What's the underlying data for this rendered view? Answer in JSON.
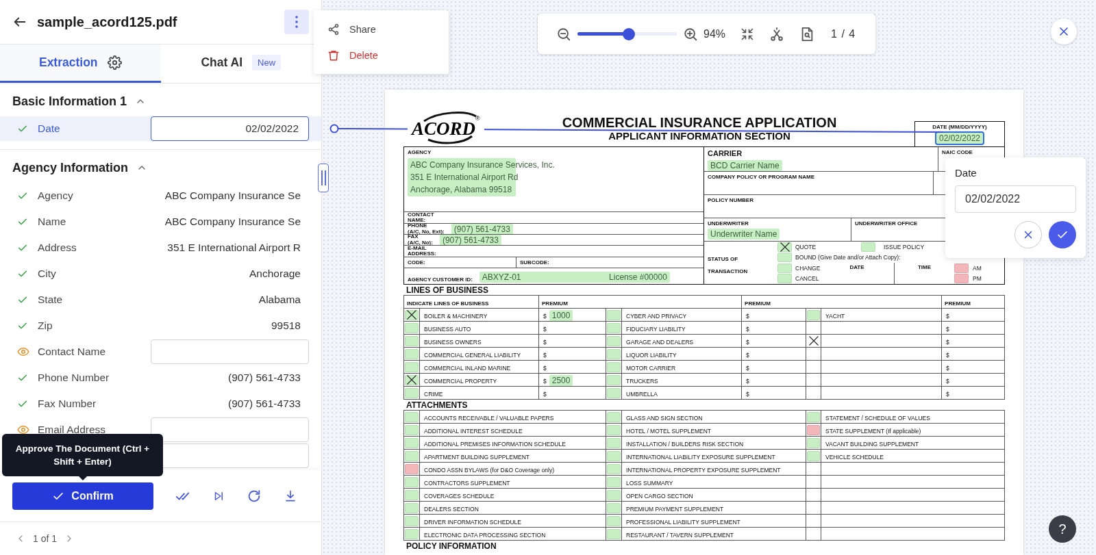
{
  "header": {
    "title": "sample_acord125.pdf"
  },
  "menu": [
    {
      "label": "Share",
      "kind": "share"
    },
    {
      "label": "Delete",
      "kind": "delete"
    }
  ],
  "tabs": [
    {
      "label": "Extraction",
      "selected": true
    },
    {
      "label": "Chat AI",
      "selected": false,
      "badge": "New"
    }
  ],
  "sections": [
    {
      "title": "Basic Information 1",
      "expanded": true,
      "fields": [
        {
          "label": "Date",
          "verified": true,
          "kind": "input",
          "value": "02/02/2022",
          "selected": true
        }
      ]
    },
    {
      "title": "Agency Information",
      "expanded": true,
      "fields": [
        {
          "label": "Agency",
          "verified": true,
          "kind": "text",
          "value": "ABC Company Insurance Se",
          "selected": false
        },
        {
          "label": "Name",
          "verified": true,
          "kind": "text",
          "value": "ABC Company Insurance Se",
          "selected": false
        },
        {
          "label": "Address",
          "verified": true,
          "kind": "text",
          "value": "351 E International Airport R",
          "selected": false
        },
        {
          "label": "City",
          "verified": true,
          "kind": "text",
          "value": "Anchorage",
          "selected": false
        },
        {
          "label": "State",
          "verified": true,
          "kind": "text",
          "value": "Alabama",
          "selected": false
        },
        {
          "label": "Zip",
          "verified": true,
          "kind": "text",
          "value": "99518",
          "selected": false
        },
        {
          "label": "Contact Name",
          "verified": false,
          "kind": "input",
          "selected": false
        },
        {
          "label": "Phone Number",
          "verified": true,
          "kind": "text",
          "value": "(907) 561-4733",
          "selected": false
        },
        {
          "label": "Fax Number",
          "verified": true,
          "kind": "text",
          "value": "(907) 561-4733",
          "selected": false
        },
        {
          "label": "Email Address",
          "verified": false,
          "kind": "input",
          "selected": false
        },
        {
          "kind": "input",
          "selected": false
        }
      ]
    }
  ],
  "tooltip": "Approve The Document (Ctrl + Shift + Enter)",
  "confirm": "Confirm",
  "pagination": {
    "text": "1 of 1"
  },
  "viewer": {
    "zoom": {
      "level": 0.52,
      "reading": "94%"
    },
    "page": "1 / 4"
  },
  "help": "?",
  "date_popup": {
    "label": "Date",
    "value": "02/02/2022"
  },
  "document": {
    "logo": "ACORD",
    "logo_mark": "®",
    "title": "COMMERCIAL INSURANCE APPLICATION",
    "subtitle": "APPLICANT INFORMATION SECTION",
    "date": {
      "label": "DATE (MM/DD/YYYY)",
      "value": "02/02/2022",
      "selected": true
    },
    "agency": {
      "label": "AGENCY",
      "lines": [
        "ABC Company Insurance Services, Inc.",
        "351 E International Airport Rd",
        "Anchorage, Alabama 99518"
      ]
    },
    "contacts": [
      {
        "label": "CONTACT\nNAME:"
      },
      {
        "label": "PHONE\n(A/C, No, Ext):",
        "value": "(907) 561-4733"
      },
      {
        "label": "FAX\n(A/C, No):",
        "value": "(907) 561-4733"
      },
      {
        "label": "E-MAIL\nADDRESS:"
      }
    ],
    "codes": [
      {
        "label": "CODE:"
      },
      {
        "label": "SUBCODE:"
      }
    ],
    "customer_id": {
      "label": "AGENCY CUSTOMER ID:",
      "value": "ABXYZ-01",
      "license": "License #00000"
    },
    "carrier": {
      "label": "CARRIER",
      "value": "BCD Carrier Name"
    },
    "naic": "NAIC CODE",
    "program": "COMPANY POLICY OR PROGRAM NAME",
    "policy_number": "POLICY NUMBER",
    "underwriter": {
      "label": "UNDERWRITER",
      "value": "Underwriter Name"
    },
    "underwriter_office": "UNDERWRITER OFFICE",
    "status": {
      "label": "STATUS OF\nTRANSACTION",
      "date_label": "DATE",
      "time_label": "TIME",
      "options": [
        {
          "label": "QUOTE",
          "checked": true,
          "color": "#c8efc3"
        },
        {
          "label": "ISSUE POLICY",
          "checked": false,
          "color": "#c8efc3"
        },
        {
          "label": "BOUND (Give Date and/or Attach Copy):",
          "checked": false,
          "color": "#c8efc3"
        },
        {
          "label": "CHANGE",
          "checked": false,
          "color": "#c8efc3"
        },
        {
          "label": "CANCEL",
          "checked": false,
          "color": "#c8efc3"
        }
      ],
      "times": [
        {
          "label": "AM",
          "checked": false,
          "color": "#f2b6bb"
        },
        {
          "label": "PM",
          "checked": false,
          "color": "#f2b6bb"
        }
      ]
    },
    "lines_of_business": {
      "title": "LINES OF BUSINESS",
      "headers": [
        "INDICATE LINES OF BUSINESS",
        "PREMIUM",
        "PREMIUM",
        "PREMIUM"
      ],
      "rows": [
        [
          {
            "checked": true,
            "color": "#c8efc3",
            "name": "BOILER & MACHINERY",
            "premium": "$",
            "amount": "1000"
          },
          {
            "checked": false,
            "color": "#c8efc3",
            "name": "CYBER AND PRIVACY",
            "premium": "$"
          },
          {
            "checked": false,
            "color": "#c8efc3",
            "name": "YACHT",
            "premium": "$"
          }
        ],
        [
          {
            "checked": false,
            "color": "#c8efc3",
            "name": "BUSINESS AUTO",
            "premium": "$"
          },
          {
            "checked": false,
            "color": "#c8efc3",
            "name": "FIDUCIARY LIABILITY",
            "premium": "$"
          },
          {
            "checked": false,
            "premium": "$"
          }
        ],
        [
          {
            "checked": false,
            "color": "#c8efc3",
            "name": "BUSINESS OWNERS",
            "premium": "$"
          },
          {
            "checked": false,
            "color": "#c8efc3",
            "name": "GARAGE AND DEALERS",
            "premium": "$"
          },
          {
            "checked": true,
            "premium": "$"
          }
        ],
        [
          {
            "checked": false,
            "color": "#c8efc3",
            "name": "COMMERCIAL GENERAL LIABILITY",
            "premium": "$"
          },
          {
            "checked": false,
            "color": "#c8efc3",
            "name": "LIQUOR LIABILITY",
            "premium": "$"
          },
          {
            "checked": false,
            "premium": "$"
          }
        ],
        [
          {
            "checked": false,
            "color": "#c8efc3",
            "name": "COMMERCIAL INLAND MARINE",
            "premium": "$"
          },
          {
            "checked": false,
            "color": "#c8efc3",
            "name": "MOTOR CARRIER",
            "premium": "$"
          },
          {
            "checked": false,
            "premium": "$"
          }
        ],
        [
          {
            "checked": true,
            "color": "#c8efc3",
            "name": "COMMERCIAL PROPERTY",
            "premium": "$",
            "amount": "2500"
          },
          {
            "checked": false,
            "color": "#c8efc3",
            "name": "TRUCKERS",
            "premium": "$"
          },
          {
            "checked": false,
            "premium": "$"
          }
        ],
        [
          {
            "checked": false,
            "color": "#c8efc3",
            "name": "CRIME",
            "premium": "$"
          },
          {
            "checked": false,
            "color": "#c8efc3",
            "name": "UMBRELLA",
            "premium": "$"
          },
          {
            "checked": false,
            "premium": "$"
          }
        ]
      ]
    },
    "attachments": {
      "title": "ATTACHMENTS",
      "rows": [
        [
          {
            "checked": false,
            "color": "#c8efc3",
            "name": "ACCOUNTS RECEIVABLE / VALUABLE PAPERS"
          },
          {
            "checked": false,
            "color": "#c8efc3",
            "name": "GLASS AND SIGN SECTION"
          },
          {
            "checked": false,
            "color": "#c8efc3",
            "name": "STATEMENT / SCHEDULE OF VALUES"
          }
        ],
        [
          {
            "checked": false,
            "color": "#c8efc3",
            "name": "ADDITIONAL INTEREST SCHEDULE"
          },
          {
            "checked": false,
            "color": "#c8efc3",
            "name": "HOTEL / MOTEL SUPPLEMENT"
          },
          {
            "checked": false,
            "color": "#f2b6bb",
            "name": "STATE SUPPLEMENT (If applicable)"
          }
        ],
        [
          {
            "checked": false,
            "color": "#c8efc3",
            "name": "ADDITIONAL PREMISES INFORMATION SCHEDULE"
          },
          {
            "checked": false,
            "color": "#c8efc3",
            "name": "INSTALLATION / BUILDERS RISK SECTION"
          },
          {
            "checked": false,
            "color": "#c8efc3",
            "name": "VACANT BUILDING SUPPLEMENT"
          }
        ],
        [
          {
            "checked": false,
            "color": "#c8efc3",
            "name": "APARTMENT BUILDING SUPPLEMENT"
          },
          {
            "checked": false,
            "color": "#c8efc3",
            "name": "INTERNATIONAL LIABILITY EXPOSURE SUPPLEMENT"
          },
          {
            "checked": false,
            "color": "#c8efc3",
            "name": "VEHICLE SCHEDULE"
          }
        ],
        [
          {
            "checked": false,
            "color": "#f2b6bb",
            "name": "CONDO ASSN BYLAWS (for D&O Coverage only)"
          },
          {
            "checked": false,
            "color": "#c8efc3",
            "name": "INTERNATIONAL PROPERTY EXPOSURE SUPPLEMENT"
          },
          {
            "checked": false
          }
        ],
        [
          {
            "checked": false,
            "color": "#c8efc3",
            "name": "CONTRACTORS SUPPLEMENT"
          },
          {
            "checked": false,
            "color": "#c8efc3",
            "name": "LOSS SUMMARY"
          },
          {
            "checked": false
          }
        ],
        [
          {
            "checked": false,
            "color": "#c8efc3",
            "name": "COVERAGES SCHEDULE"
          },
          {
            "checked": false,
            "color": "#c8efc3",
            "name": "OPEN CARGO SECTION"
          },
          {
            "checked": false
          }
        ],
        [
          {
            "checked": false,
            "color": "#c8efc3",
            "name": "DEALERS SECTION"
          },
          {
            "checked": false,
            "color": "#c8efc3",
            "name": "PREMIUM PAYMENT SUPPLEMENT"
          },
          {
            "checked": false
          }
        ],
        [
          {
            "checked": false,
            "color": "#c8efc3",
            "name": "DRIVER INFORMATION SCHEDULE"
          },
          {
            "checked": false,
            "color": "#c8efc3",
            "name": "PROFESSIONAL LIABILITY SUPPLEMENT"
          },
          {
            "checked": false
          }
        ],
        [
          {
            "checked": false,
            "color": "#c8efc3",
            "name": "ELECTRONIC DATA PROCESSING SECTION"
          },
          {
            "checked": false,
            "color": "#c8efc3",
            "name": "RESTAURANT / TAVERN SUPPLEMENT"
          },
          {
            "checked": false
          }
        ]
      ]
    },
    "next_section": "POLICY INFORMATION"
  }
}
